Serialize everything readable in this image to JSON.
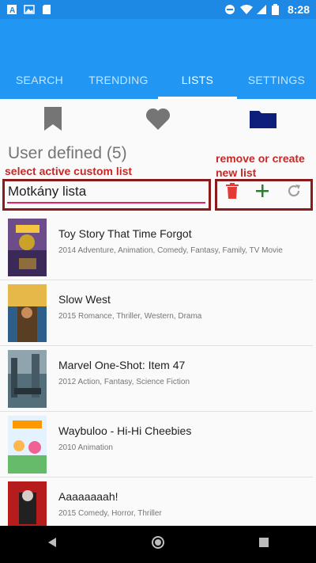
{
  "status": {
    "time": "8:28"
  },
  "tabs": [
    {
      "label": "SEARCH",
      "active": false
    },
    {
      "label": "TRENDING",
      "active": false
    },
    {
      "label": "LISTS",
      "active": true
    },
    {
      "label": "SETTINGS",
      "active": false
    }
  ],
  "subtabs": {
    "active": "folder"
  },
  "section": {
    "title": "User defined (5)"
  },
  "annotations": {
    "select": "select active custom list",
    "remove_create_line1": "remove or create",
    "remove_create_line2": "new list"
  },
  "list_select": {
    "value": "Motkány lista"
  },
  "colors": {
    "accent": "#2196f3",
    "annotation": "#c62828",
    "delete": "#e53935",
    "add": "#2e7d32"
  },
  "movies": [
    {
      "title": "Toy Story That Time Forgot",
      "meta": "2014  Adventure, Animation, Comedy, Fantasy, Family, TV Movie"
    },
    {
      "title": "Slow West",
      "meta": "2015  Romance, Thriller, Western, Drama"
    },
    {
      "title": "Marvel One-Shot: Item 47",
      "meta": "2012  Action, Fantasy, Science Fiction"
    },
    {
      "title": "Waybuloo - Hi-Hi Cheebies",
      "meta": "2010  Animation"
    },
    {
      "title": "Aaaaaaaah!",
      "meta": "2015  Comedy, Horror, Thriller"
    }
  ]
}
